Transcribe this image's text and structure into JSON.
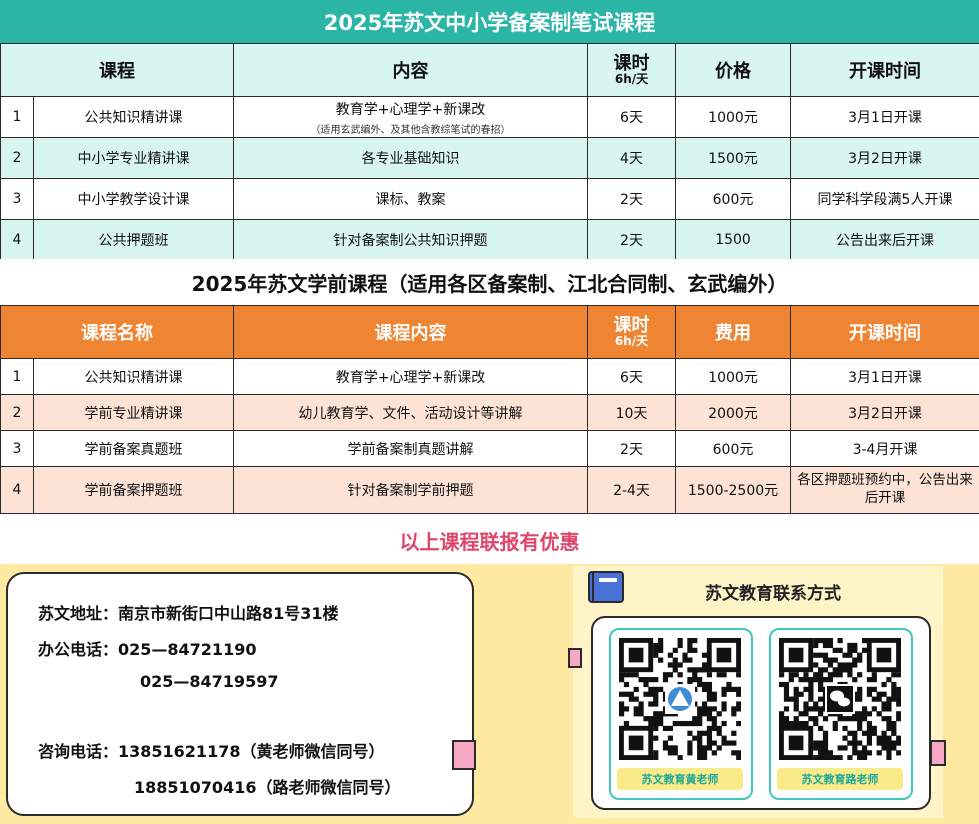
{
  "section1": {
    "title": "2025年苏文中小学备案制笔试课程",
    "headers": {
      "course": "课程",
      "content": "内容",
      "hours": "课时",
      "hours_sub": "6h/天",
      "price": "价格",
      "start": "开课时间"
    },
    "rows": [
      {
        "no": "1",
        "course": "公共知识精讲课",
        "content": "教育学+心理学+新课改",
        "note": "（适用玄武编外、及其他含教综笔试的春招）",
        "hours": "6天",
        "price": "1000元",
        "start": "3月1日开课"
      },
      {
        "no": "2",
        "course": "中小学专业精讲课",
        "content": "各专业基础知识",
        "hours": "4天",
        "price": "1500元",
        "start": "3月2日开课"
      },
      {
        "no": "3",
        "course": "中小学教学设计课",
        "content": "课标、教案",
        "hours": "2天",
        "price": "600元",
        "start": "同学科学段满5人开课"
      },
      {
        "no": "4",
        "course": "公共押题班",
        "content": "针对备案制公共知识押题",
        "hours": "2天",
        "price": "1500",
        "start": "公告出来后开课"
      }
    ]
  },
  "section2": {
    "title": "2025年苏文学前课程（适用各区备案制、江北合同制、玄武编外）",
    "headers": {
      "course": "课程名称",
      "content": "课程内容",
      "hours": "课时",
      "hours_sub": "6h/天",
      "price": "费用",
      "start": "开课时间"
    },
    "rows": [
      {
        "no": "1",
        "course": "公共知识精讲课",
        "content": "教育学+心理学+新课改",
        "hours": "6天",
        "price": "1000元",
        "start": "3月1日开课"
      },
      {
        "no": "2",
        "course": "学前专业精讲课",
        "content": "幼儿教育学、文件、活动设计等讲解",
        "hours": "10天",
        "price": "2000元",
        "start": "3月2日开课"
      },
      {
        "no": "3",
        "course": "学前备案真题班",
        "content": "学前备案制真题讲解",
        "hours": "2天",
        "price": "600元",
        "start": "3-4月开课"
      },
      {
        "no": "4",
        "course": "学前备案押题班",
        "content": "针对备案制学前押题",
        "hours": "2-4天",
        "price": "1500-2500元",
        "start": "各区押题班预约中，公告出来后开课"
      }
    ],
    "promo": "以上课程联报有优惠"
  },
  "contact": {
    "address": "苏文地址：南京市新街口中山路81号31楼",
    "office_phone": "办公电话：025—84721190",
    "office_phone2": "025—84719597",
    "consult_phone": "咨询电话：13851621178（黄老师微信同号）",
    "consult_phone2": "18851070416（路老师微信同号）"
  },
  "qr": {
    "title": "苏文教育联系方式",
    "cards": [
      {
        "caption": "苏文教育黄老师",
        "center_icon": "logo-icon"
      },
      {
        "caption": "苏文教育路老师",
        "center_icon": "wechat-icon"
      }
    ]
  },
  "colors": {
    "teal": "#2bb5a6",
    "mint": "#d8f5f0",
    "orange": "#ef8432",
    "peach": "#fde3d6",
    "promo": "#e0456a",
    "footer": "#ffe9a2"
  }
}
